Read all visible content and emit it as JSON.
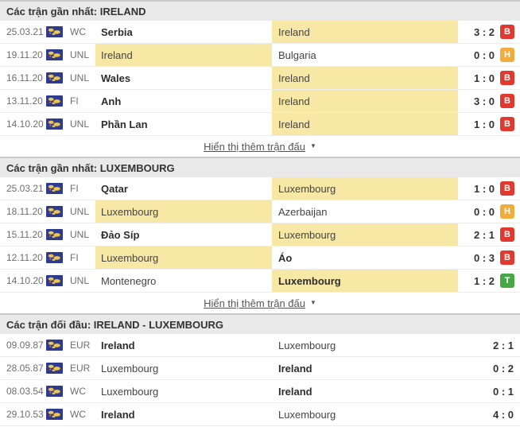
{
  "result_colors": {
    "win": "#47a747",
    "draw": "#f0ad3e",
    "loss": "#e0392f"
  },
  "highlight_color": "#f8e8a6",
  "show_more": {
    "label": "Hiển thị thêm trận đấu",
    "chevron": "▼"
  },
  "icons": {
    "flag": "world-flag-icon"
  },
  "sections": [
    {
      "title": "Các trận gần nhất: IRELAND",
      "show_more": true,
      "rows": [
        {
          "date": "25.03.21",
          "competition": "WC",
          "home": {
            "name": "Serbia",
            "winner": true,
            "highlighted": false
          },
          "away": {
            "name": "Ireland",
            "winner": false,
            "highlighted": true
          },
          "score": "3 : 2",
          "result": {
            "label": "B",
            "type": "loss"
          }
        },
        {
          "date": "19.11.20",
          "competition": "UNL",
          "home": {
            "name": "Ireland",
            "winner": false,
            "highlighted": true
          },
          "away": {
            "name": "Bulgaria",
            "winner": false,
            "highlighted": false
          },
          "score": "0 : 0",
          "result": {
            "label": "H",
            "type": "draw"
          }
        },
        {
          "date": "16.11.20",
          "competition": "UNL",
          "home": {
            "name": "Wales",
            "winner": true,
            "highlighted": false
          },
          "away": {
            "name": "Ireland",
            "winner": false,
            "highlighted": true
          },
          "score": "1 : 0",
          "result": {
            "label": "B",
            "type": "loss"
          }
        },
        {
          "date": "13.11.20",
          "competition": "FI",
          "home": {
            "name": "Anh",
            "winner": true,
            "highlighted": false
          },
          "away": {
            "name": "Ireland",
            "winner": false,
            "highlighted": true
          },
          "score": "3 : 0",
          "result": {
            "label": "B",
            "type": "loss"
          }
        },
        {
          "date": "14.10.20",
          "competition": "UNL",
          "home": {
            "name": "Phần Lan",
            "winner": true,
            "highlighted": false
          },
          "away": {
            "name": "Ireland",
            "winner": false,
            "highlighted": true
          },
          "score": "1 : 0",
          "result": {
            "label": "B",
            "type": "loss"
          }
        }
      ]
    },
    {
      "title": "Các trận gần nhất: LUXEMBOURG",
      "show_more": true,
      "rows": [
        {
          "date": "25.03.21",
          "competition": "FI",
          "home": {
            "name": "Qatar",
            "winner": true,
            "highlighted": false
          },
          "away": {
            "name": "Luxembourg",
            "winner": false,
            "highlighted": true
          },
          "score": "1 : 0",
          "result": {
            "label": "B",
            "type": "loss"
          }
        },
        {
          "date": "18.11.20",
          "competition": "UNL",
          "home": {
            "name": "Luxembourg",
            "winner": false,
            "highlighted": true
          },
          "away": {
            "name": "Azerbaijan",
            "winner": false,
            "highlighted": false
          },
          "score": "0 : 0",
          "result": {
            "label": "H",
            "type": "draw"
          }
        },
        {
          "date": "15.11.20",
          "competition": "UNL",
          "home": {
            "name": "Đảo Síp",
            "winner": true,
            "highlighted": false
          },
          "away": {
            "name": "Luxembourg",
            "winner": false,
            "highlighted": true
          },
          "score": "2 : 1",
          "result": {
            "label": "B",
            "type": "loss"
          }
        },
        {
          "date": "12.11.20",
          "competition": "FI",
          "home": {
            "name": "Luxembourg",
            "winner": false,
            "highlighted": true
          },
          "away": {
            "name": "Áo",
            "winner": true,
            "highlighted": false
          },
          "score": "0 : 3",
          "result": {
            "label": "B",
            "type": "loss"
          }
        },
        {
          "date": "14.10.20",
          "competition": "UNL",
          "home": {
            "name": "Montenegro",
            "winner": false,
            "highlighted": false
          },
          "away": {
            "name": "Luxembourg",
            "winner": true,
            "highlighted": true
          },
          "score": "1 : 2",
          "result": {
            "label": "T",
            "type": "win"
          }
        }
      ]
    },
    {
      "title": "Các trận đối đầu: IRELAND - LUXEMBOURG",
      "show_more": false,
      "rows": [
        {
          "date": "09.09.87",
          "competition": "EUR",
          "home": {
            "name": "Ireland",
            "winner": true,
            "highlighted": false
          },
          "away": {
            "name": "Luxembourg",
            "winner": false,
            "highlighted": false
          },
          "score": "2 : 1",
          "result": null
        },
        {
          "date": "28.05.87",
          "competition": "EUR",
          "home": {
            "name": "Luxembourg",
            "winner": false,
            "highlighted": false
          },
          "away": {
            "name": "Ireland",
            "winner": true,
            "highlighted": false
          },
          "score": "0 : 2",
          "result": null
        },
        {
          "date": "08.03.54",
          "competition": "WC",
          "home": {
            "name": "Luxembourg",
            "winner": false,
            "highlighted": false
          },
          "away": {
            "name": "Ireland",
            "winner": true,
            "highlighted": false
          },
          "score": "0 : 1",
          "result": null
        },
        {
          "date": "29.10.53",
          "competition": "WC",
          "home": {
            "name": "Ireland",
            "winner": true,
            "highlighted": false
          },
          "away": {
            "name": "Luxembourg",
            "winner": false,
            "highlighted": false
          },
          "score": "4 : 0",
          "result": null
        }
      ]
    }
  ]
}
